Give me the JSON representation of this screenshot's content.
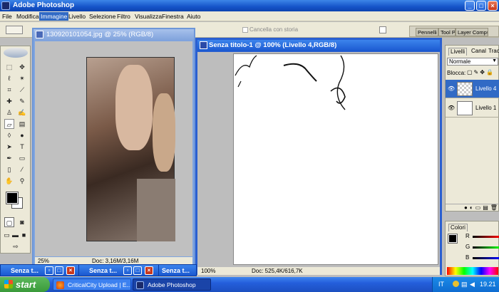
{
  "app": {
    "title": "Adobe Photoshop"
  },
  "menu": [
    "File",
    "Modifica",
    "Immagine",
    "Livello",
    "Selezione",
    "Filtro",
    "Visualizza",
    "Finestra",
    "Aiuto"
  ],
  "options": {
    "history_label": "Cancella con storia"
  },
  "palette_well": [
    "Pennelli",
    "Tool Pr",
    "Layer Comps"
  ],
  "doc1": {
    "title": "130920101054.jpg @ 25% (RGB/8)",
    "zoom": "25%",
    "info": "Doc: 3,16M/3,16M"
  },
  "doc2": {
    "title": "Senza titolo-1 @ 100% (Livello 4,RGB/8)",
    "zoom": "100%",
    "info": "Doc: 525,4K/616,7K"
  },
  "layers_panel": {
    "tabs": [
      "Livelli",
      "Canal",
      "Trac"
    ],
    "blend_mode": "Normale",
    "lock_label": "Blocca:",
    "layers": [
      {
        "name": "Livello 4",
        "selected": true
      },
      {
        "name": "Livello 1",
        "selected": false
      }
    ]
  },
  "colors_panel": {
    "title": "Colori",
    "channels": [
      "R",
      "G",
      "B"
    ]
  },
  "minimized": [
    {
      "title": "Senza t..."
    },
    {
      "title": "Senza t..."
    },
    {
      "title": "Senza t..."
    }
  ],
  "taskbar": {
    "start": "start",
    "items": [
      {
        "label": "CriticalCity Upload | E..."
      },
      {
        "label": "Adobe Photoshop"
      }
    ],
    "lang": "IT",
    "time": "19.21"
  },
  "colors": {
    "xp_blue": "#245edb",
    "accent": "#316ac5",
    "start_green": "#3a9a3a"
  }
}
